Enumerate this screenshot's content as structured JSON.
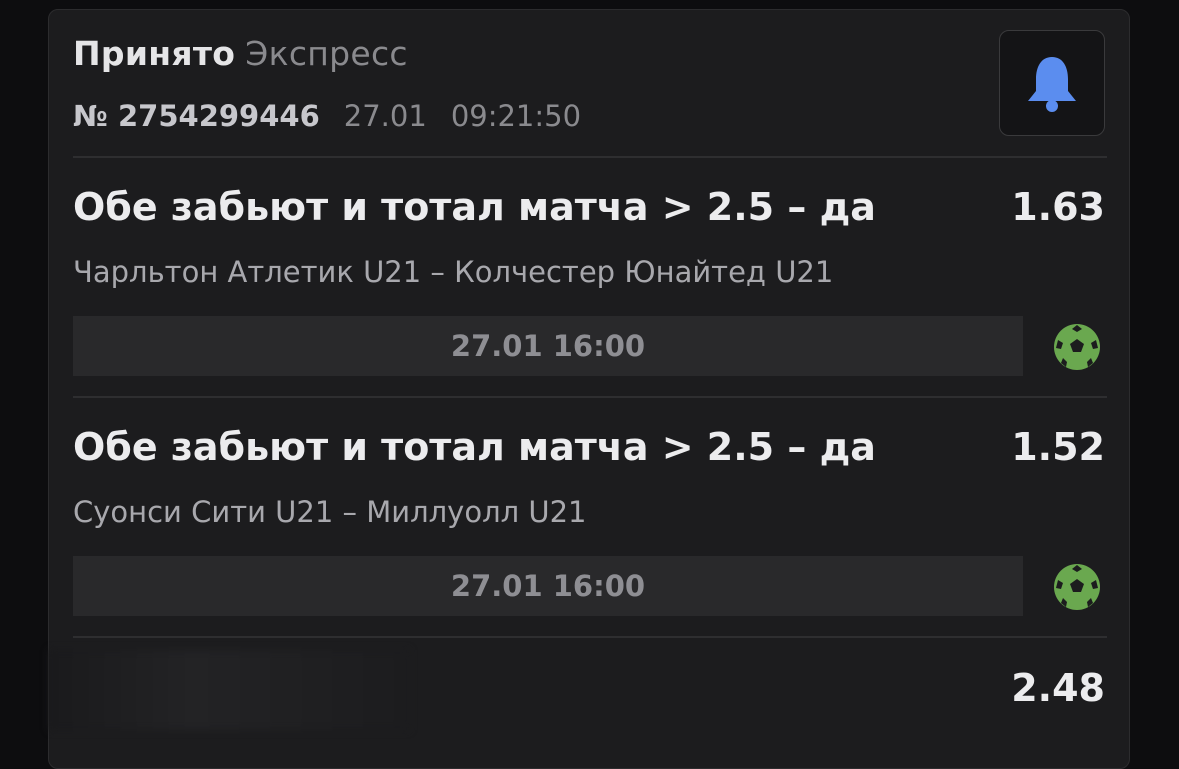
{
  "header": {
    "status": "Принято",
    "bet_type": "Экспресс",
    "number": "№ 2754299446",
    "date": "27.01",
    "time": "09:21:50"
  },
  "bets": [
    {
      "title": "Обе забьют и тотал матча > 2.5 – да",
      "odds": "1.63",
      "match": "Чарльтон Атлетик U21 – Колчестер Юнайтед U21",
      "datetime": "27.01 16:00",
      "sport_icon": "football-icon"
    },
    {
      "title": "Обе забьют и тотал матча > 2.5 – да",
      "odds": "1.52",
      "match": "Суонси Сити U21 – Миллуолл U21",
      "datetime": "27.01 16:00",
      "sport_icon": "football-icon"
    },
    {
      "odds": "2.48"
    }
  ],
  "colors": {
    "bell": "#5b8def",
    "ball": "#6aa84f"
  }
}
